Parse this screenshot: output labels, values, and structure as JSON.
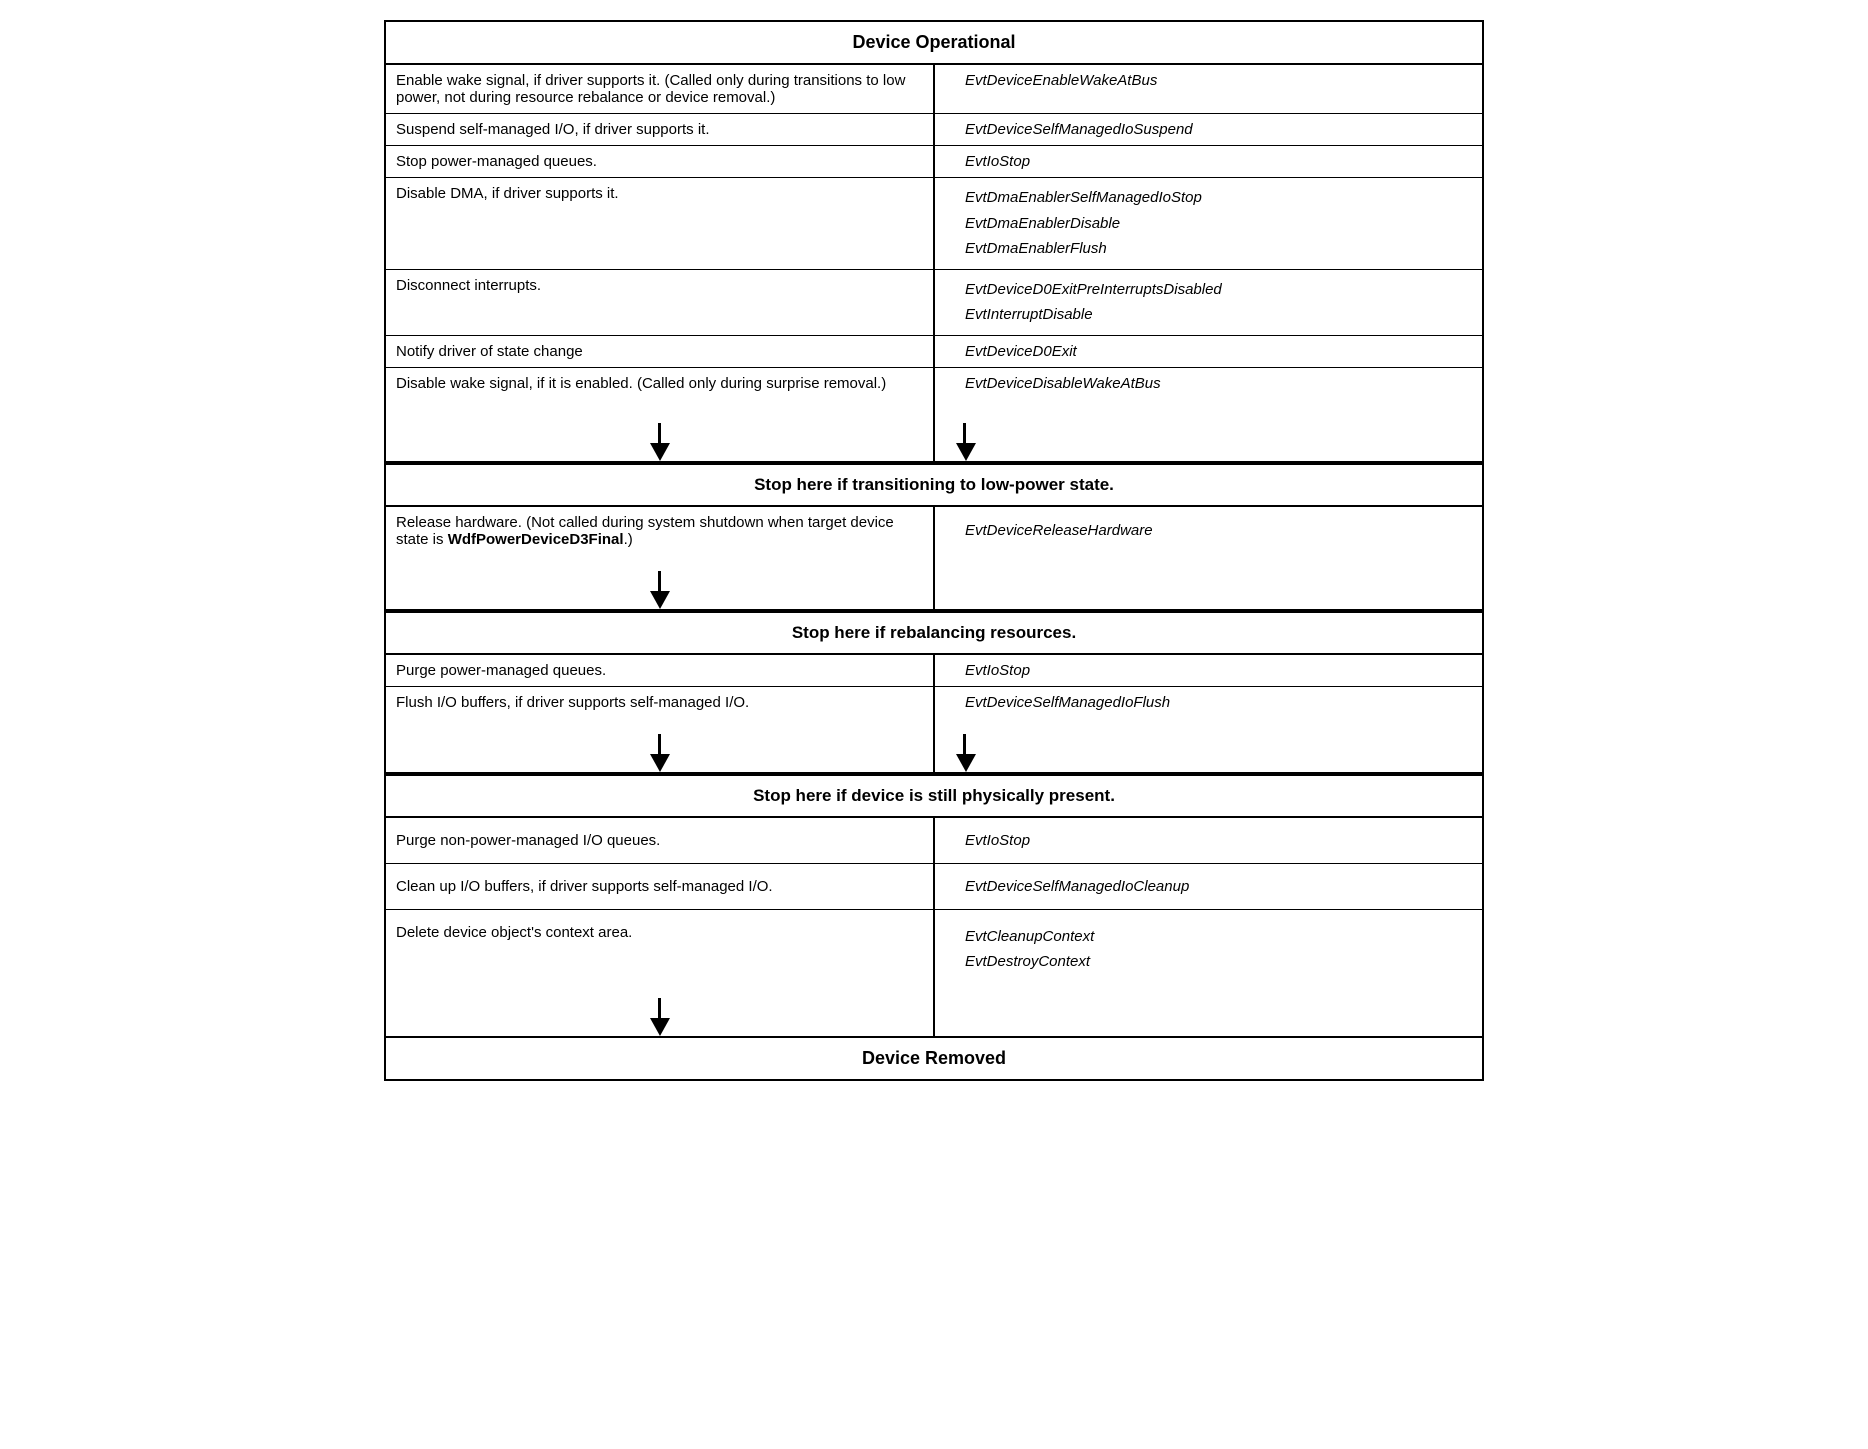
{
  "title": "Device Operational",
  "footer": "Device Removed",
  "stop_labels": {
    "low_power": "Stop here if transitioning to low-power state.",
    "rebalancing": "Stop here if rebalancing resources.",
    "physically_present": "Stop here if device is still physically present."
  },
  "rows_section1": [
    {
      "left": "Enable wake signal, if driver supports it. (Called only during transitions to low power, not during resource rebalance or device removal.)",
      "right": "EvtDeviceEnableWakeAtBus",
      "arrow": false
    },
    {
      "left": "Suspend self-managed I/O, if driver supports it.",
      "right": "EvtDeviceSelfManagedIoSuspend",
      "arrow": false
    },
    {
      "left": "Stop power-managed queues.",
      "right": "EvtIoStop",
      "arrow": false
    },
    {
      "left": "Disable DMA, if driver supports it.",
      "right_multi": [
        "EvtDmaEnablerSelfManagedIoStop",
        "EvtDmaEnablerDisable",
        "EvtDmaEnablerFlush"
      ],
      "arrow": false
    },
    {
      "left": "Disconnect interrupts.",
      "right_multi": [
        "EvtDeviceD0ExitPreInterruptsDisabled",
        "EvtInterruptDisable"
      ],
      "arrow": false
    },
    {
      "left": "Notify driver of state change",
      "right": "EvtDeviceD0Exit",
      "arrow": false
    },
    {
      "left": "Disable wake signal, if it is enabled. (Called only during surprise removal.)",
      "right": "EvtDeviceDisableWakeAtBus",
      "arrow": true
    }
  ],
  "rows_section2": [
    {
      "left": "Release hardware. (Not called during system shutdown when target device state is WdfPowerDeviceD3Final.)",
      "left_bold": "WdfPowerDeviceD3Final",
      "right": "EvtDeviceReleaseHardware",
      "arrow": true
    }
  ],
  "rows_section3": [
    {
      "left": "Purge power-managed queues.",
      "right": "EvtIoStop",
      "arrow": false
    },
    {
      "left": "Flush I/O buffers, if driver supports self-managed I/O.",
      "right": "EvtDeviceSelfManagedIoFlush",
      "arrow": true
    }
  ],
  "rows_section4": [
    {
      "left": "Purge non-power-managed I/O queues.",
      "right": "EvtIoStop",
      "arrow": false
    },
    {
      "left": "Clean up I/O buffers, if driver supports self-managed I/O.",
      "right": "EvtDeviceSelfManagedIoCleanup",
      "arrow": false
    },
    {
      "left": "Delete device object's context area.",
      "right_multi": [
        "EvtCleanupContext",
        "EvtDestroyContext"
      ],
      "arrow": true
    }
  ]
}
